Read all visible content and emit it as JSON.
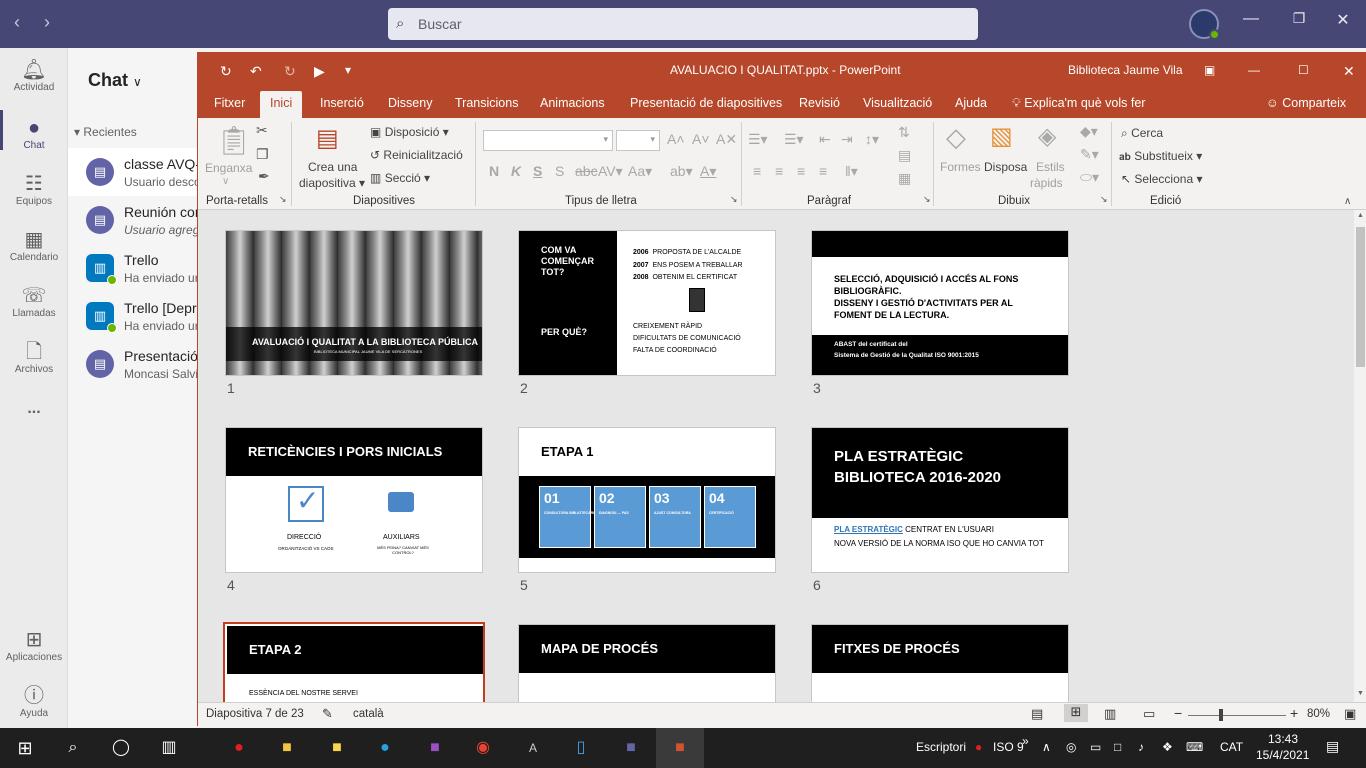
{
  "teams": {
    "search_placeholder": "Buscar",
    "rail": [
      {
        "label": "Actividad",
        "icon": "bell-icon"
      },
      {
        "label": "Chat",
        "icon": "chat-icon"
      },
      {
        "label": "Equipos",
        "icon": "teams-icon"
      },
      {
        "label": "Calendario",
        "icon": "calendar-icon"
      },
      {
        "label": "Llamadas",
        "icon": "phone-icon"
      },
      {
        "label": "Archivos",
        "icon": "file-icon"
      },
      {
        "label": "...",
        "icon": "more-icon"
      },
      {
        "label": "Aplicaciones",
        "icon": "apps-icon"
      },
      {
        "label": "Ayuda",
        "icon": "help-icon"
      }
    ],
    "chat_title": "Chat",
    "recent_label": "Recientes",
    "chats": [
      {
        "title": "classe AVQ-",
        "subtitle": "Usuario desco"
      },
      {
        "title": "Reunión cor",
        "subtitle": "Usuario agreg"
      },
      {
        "title": "Trello",
        "subtitle": "Ha enviado ur"
      },
      {
        "title": "Trello [Depr",
        "subtitle": "Ha enviado ur"
      },
      {
        "title": "Presentació",
        "subtitle": "Moncasi Salvi"
      }
    ]
  },
  "ppt": {
    "filename": "AVALUACIO I QUALITAT.pptx",
    "separator": "-",
    "app": "PowerPoint",
    "user": "Biblioteca Jaume Vila",
    "menu": [
      "Fitxer",
      "Inici",
      "Inserció",
      "Disseny",
      "Transicions",
      "Animacions",
      "Presentació de diapositives",
      "Revisió",
      "Visualització",
      "Ajuda"
    ],
    "tell_me": "Explica'm què vols fer",
    "share": "Comparteix",
    "ribbon": {
      "paste": "Enganxa",
      "new_slide_1": "Crea una",
      "new_slide_2": "diapositiva",
      "layout": "Disposició",
      "reset": "Reinicialització",
      "section": "Secció",
      "shapes": "Formes",
      "arrange": "Disposa",
      "styles_1": "Estils",
      "styles_2": "ràpids",
      "find": "Cerca",
      "replace": "Substitueix",
      "select": "Selecciona",
      "groups": [
        "Porta-retalls",
        "Diapositives",
        "Tipus de lletra",
        "Paràgraf",
        "Dibuix",
        "Edició"
      ]
    },
    "slides": [
      {
        "num": "1",
        "title": "AVALUACIÓ I QUALITAT A LA BIBLIOTECA PÚBLICA",
        "subtitle": "BIBLIOTECA MUNICIPAL JAUME VILA DE SERCÀTRONES"
      },
      {
        "num": "2",
        "left_top": "COM VA COMENÇAR TOT?",
        "left_bottom": "PER QUÈ?",
        "years": [
          {
            "y": "2006",
            "t": "PROPOSTA DE L'ALCALDE"
          },
          {
            "y": "2007",
            "t": "ENS POSEM A TREBALLAR"
          },
          {
            "y": "2008",
            "t": "OBTENIM EL CERTIFICAT"
          }
        ],
        "reasons": [
          "CREIXEMENT RÀPID",
          "DIFICULTATS DE COMUNICACIÓ",
          "FALTA DE COORDINACIÓ"
        ]
      },
      {
        "num": "3",
        "lines": [
          "SELECCIÓ, ADQUISICIÓ I ACCÉS AL FONS",
          "BIBLIOGRÀFIC.",
          "DISSENY I GESTIÓ D'ACTIVITATS PER AL",
          "FOMENT DE LA LECTURA."
        ],
        "footer_1": "ABAST del certificat del",
        "footer_2": "Sistema de Gestió de la Qualitat ISO 9001:2015"
      },
      {
        "num": "4",
        "title": "RETICÈNCIES I PORS INICIALS",
        "a_label": "DIRECCIÓ",
        "a_sub": "ORGANITZACIÓ VS CAOS",
        "b_label": "AUXILIARS",
        "b_sub": "MÉS FEINA? CANVIAT MÉS CONTROL?"
      },
      {
        "num": "5",
        "title": "ETAPA 1",
        "boxes": [
          {
            "n": "01",
            "t": "CONSULTORA BIBLIOTECÀRIA EXTERNA"
          },
          {
            "n": "02",
            "t": "DIAGNOSI — PAS"
          },
          {
            "n": "03",
            "t": "AJUST CONSULTORA"
          },
          {
            "n": "04",
            "t": "CERTIFICACIÓ"
          }
        ]
      },
      {
        "num": "6",
        "title_1": "PLA ESTRATÈGIC",
        "title_2": "BIBLIOTECA 2016-2020",
        "link": "PLA ESTRATÈGIC",
        "line_1_rest": "CENTRAT EN L'USUARI",
        "line_2": "NOVA VERSIÓ DE LA NORMA ISO QUE HO CANVIA TOT"
      },
      {
        "num": "7",
        "title": "ETAPA 2",
        "text": "ESSÈNCIA DEL NOSTRE SERVEI"
      },
      {
        "num": "8",
        "title": "MAPA DE PROCÉS"
      },
      {
        "num": "9",
        "title": "FITXES DE PROCÉS"
      }
    ],
    "status": {
      "slide": "Diapositiva 7 de 23",
      "language": "català",
      "zoom": "80%"
    }
  },
  "taskbar": {
    "writing": "Escriptori",
    "iso": "ISO 9",
    "lang": "CAT",
    "time": "13:43",
    "date": "15/4/2021"
  }
}
